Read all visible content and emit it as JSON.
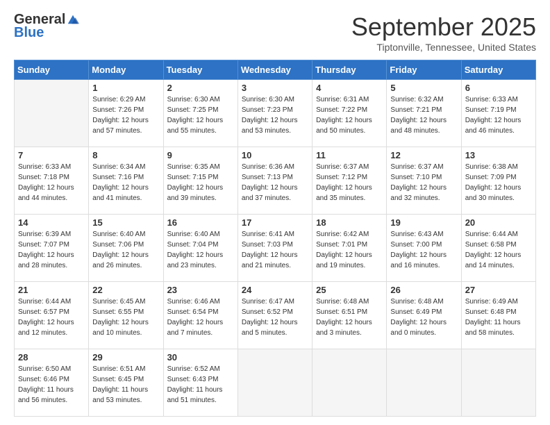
{
  "logo": {
    "general": "General",
    "blue": "Blue"
  },
  "title": "September 2025",
  "location": "Tiptonville, Tennessee, United States",
  "days_of_week": [
    "Sunday",
    "Monday",
    "Tuesday",
    "Wednesday",
    "Thursday",
    "Friday",
    "Saturday"
  ],
  "weeks": [
    [
      {
        "day": "",
        "sunrise": "",
        "sunset": "",
        "daylight": ""
      },
      {
        "day": "1",
        "sunrise": "6:29 AM",
        "sunset": "7:26 PM",
        "daylight": "12 hours and 57 minutes."
      },
      {
        "day": "2",
        "sunrise": "6:30 AM",
        "sunset": "7:25 PM",
        "daylight": "12 hours and 55 minutes."
      },
      {
        "day": "3",
        "sunrise": "6:30 AM",
        "sunset": "7:23 PM",
        "daylight": "12 hours and 53 minutes."
      },
      {
        "day": "4",
        "sunrise": "6:31 AM",
        "sunset": "7:22 PM",
        "daylight": "12 hours and 50 minutes."
      },
      {
        "day": "5",
        "sunrise": "6:32 AM",
        "sunset": "7:21 PM",
        "daylight": "12 hours and 48 minutes."
      },
      {
        "day": "6",
        "sunrise": "6:33 AM",
        "sunset": "7:19 PM",
        "daylight": "12 hours and 46 minutes."
      }
    ],
    [
      {
        "day": "7",
        "sunrise": "6:33 AM",
        "sunset": "7:18 PM",
        "daylight": "12 hours and 44 minutes."
      },
      {
        "day": "8",
        "sunrise": "6:34 AM",
        "sunset": "7:16 PM",
        "daylight": "12 hours and 41 minutes."
      },
      {
        "day": "9",
        "sunrise": "6:35 AM",
        "sunset": "7:15 PM",
        "daylight": "12 hours and 39 minutes."
      },
      {
        "day": "10",
        "sunrise": "6:36 AM",
        "sunset": "7:13 PM",
        "daylight": "12 hours and 37 minutes."
      },
      {
        "day": "11",
        "sunrise": "6:37 AM",
        "sunset": "7:12 PM",
        "daylight": "12 hours and 35 minutes."
      },
      {
        "day": "12",
        "sunrise": "6:37 AM",
        "sunset": "7:10 PM",
        "daylight": "12 hours and 32 minutes."
      },
      {
        "day": "13",
        "sunrise": "6:38 AM",
        "sunset": "7:09 PM",
        "daylight": "12 hours and 30 minutes."
      }
    ],
    [
      {
        "day": "14",
        "sunrise": "6:39 AM",
        "sunset": "7:07 PM",
        "daylight": "12 hours and 28 minutes."
      },
      {
        "day": "15",
        "sunrise": "6:40 AM",
        "sunset": "7:06 PM",
        "daylight": "12 hours and 26 minutes."
      },
      {
        "day": "16",
        "sunrise": "6:40 AM",
        "sunset": "7:04 PM",
        "daylight": "12 hours and 23 minutes."
      },
      {
        "day": "17",
        "sunrise": "6:41 AM",
        "sunset": "7:03 PM",
        "daylight": "12 hours and 21 minutes."
      },
      {
        "day": "18",
        "sunrise": "6:42 AM",
        "sunset": "7:01 PM",
        "daylight": "12 hours and 19 minutes."
      },
      {
        "day": "19",
        "sunrise": "6:43 AM",
        "sunset": "7:00 PM",
        "daylight": "12 hours and 16 minutes."
      },
      {
        "day": "20",
        "sunrise": "6:44 AM",
        "sunset": "6:58 PM",
        "daylight": "12 hours and 14 minutes."
      }
    ],
    [
      {
        "day": "21",
        "sunrise": "6:44 AM",
        "sunset": "6:57 PM",
        "daylight": "12 hours and 12 minutes."
      },
      {
        "day": "22",
        "sunrise": "6:45 AM",
        "sunset": "6:55 PM",
        "daylight": "12 hours and 10 minutes."
      },
      {
        "day": "23",
        "sunrise": "6:46 AM",
        "sunset": "6:54 PM",
        "daylight": "12 hours and 7 minutes."
      },
      {
        "day": "24",
        "sunrise": "6:47 AM",
        "sunset": "6:52 PM",
        "daylight": "12 hours and 5 minutes."
      },
      {
        "day": "25",
        "sunrise": "6:48 AM",
        "sunset": "6:51 PM",
        "daylight": "12 hours and 3 minutes."
      },
      {
        "day": "26",
        "sunrise": "6:48 AM",
        "sunset": "6:49 PM",
        "daylight": "12 hours and 0 minutes."
      },
      {
        "day": "27",
        "sunrise": "6:49 AM",
        "sunset": "6:48 PM",
        "daylight": "11 hours and 58 minutes."
      }
    ],
    [
      {
        "day": "28",
        "sunrise": "6:50 AM",
        "sunset": "6:46 PM",
        "daylight": "11 hours and 56 minutes."
      },
      {
        "day": "29",
        "sunrise": "6:51 AM",
        "sunset": "6:45 PM",
        "daylight": "11 hours and 53 minutes."
      },
      {
        "day": "30",
        "sunrise": "6:52 AM",
        "sunset": "6:43 PM",
        "daylight": "11 hours and 51 minutes."
      },
      {
        "day": "",
        "sunrise": "",
        "sunset": "",
        "daylight": ""
      },
      {
        "day": "",
        "sunrise": "",
        "sunset": "",
        "daylight": ""
      },
      {
        "day": "",
        "sunrise": "",
        "sunset": "",
        "daylight": ""
      },
      {
        "day": "",
        "sunrise": "",
        "sunset": "",
        "daylight": ""
      }
    ]
  ]
}
